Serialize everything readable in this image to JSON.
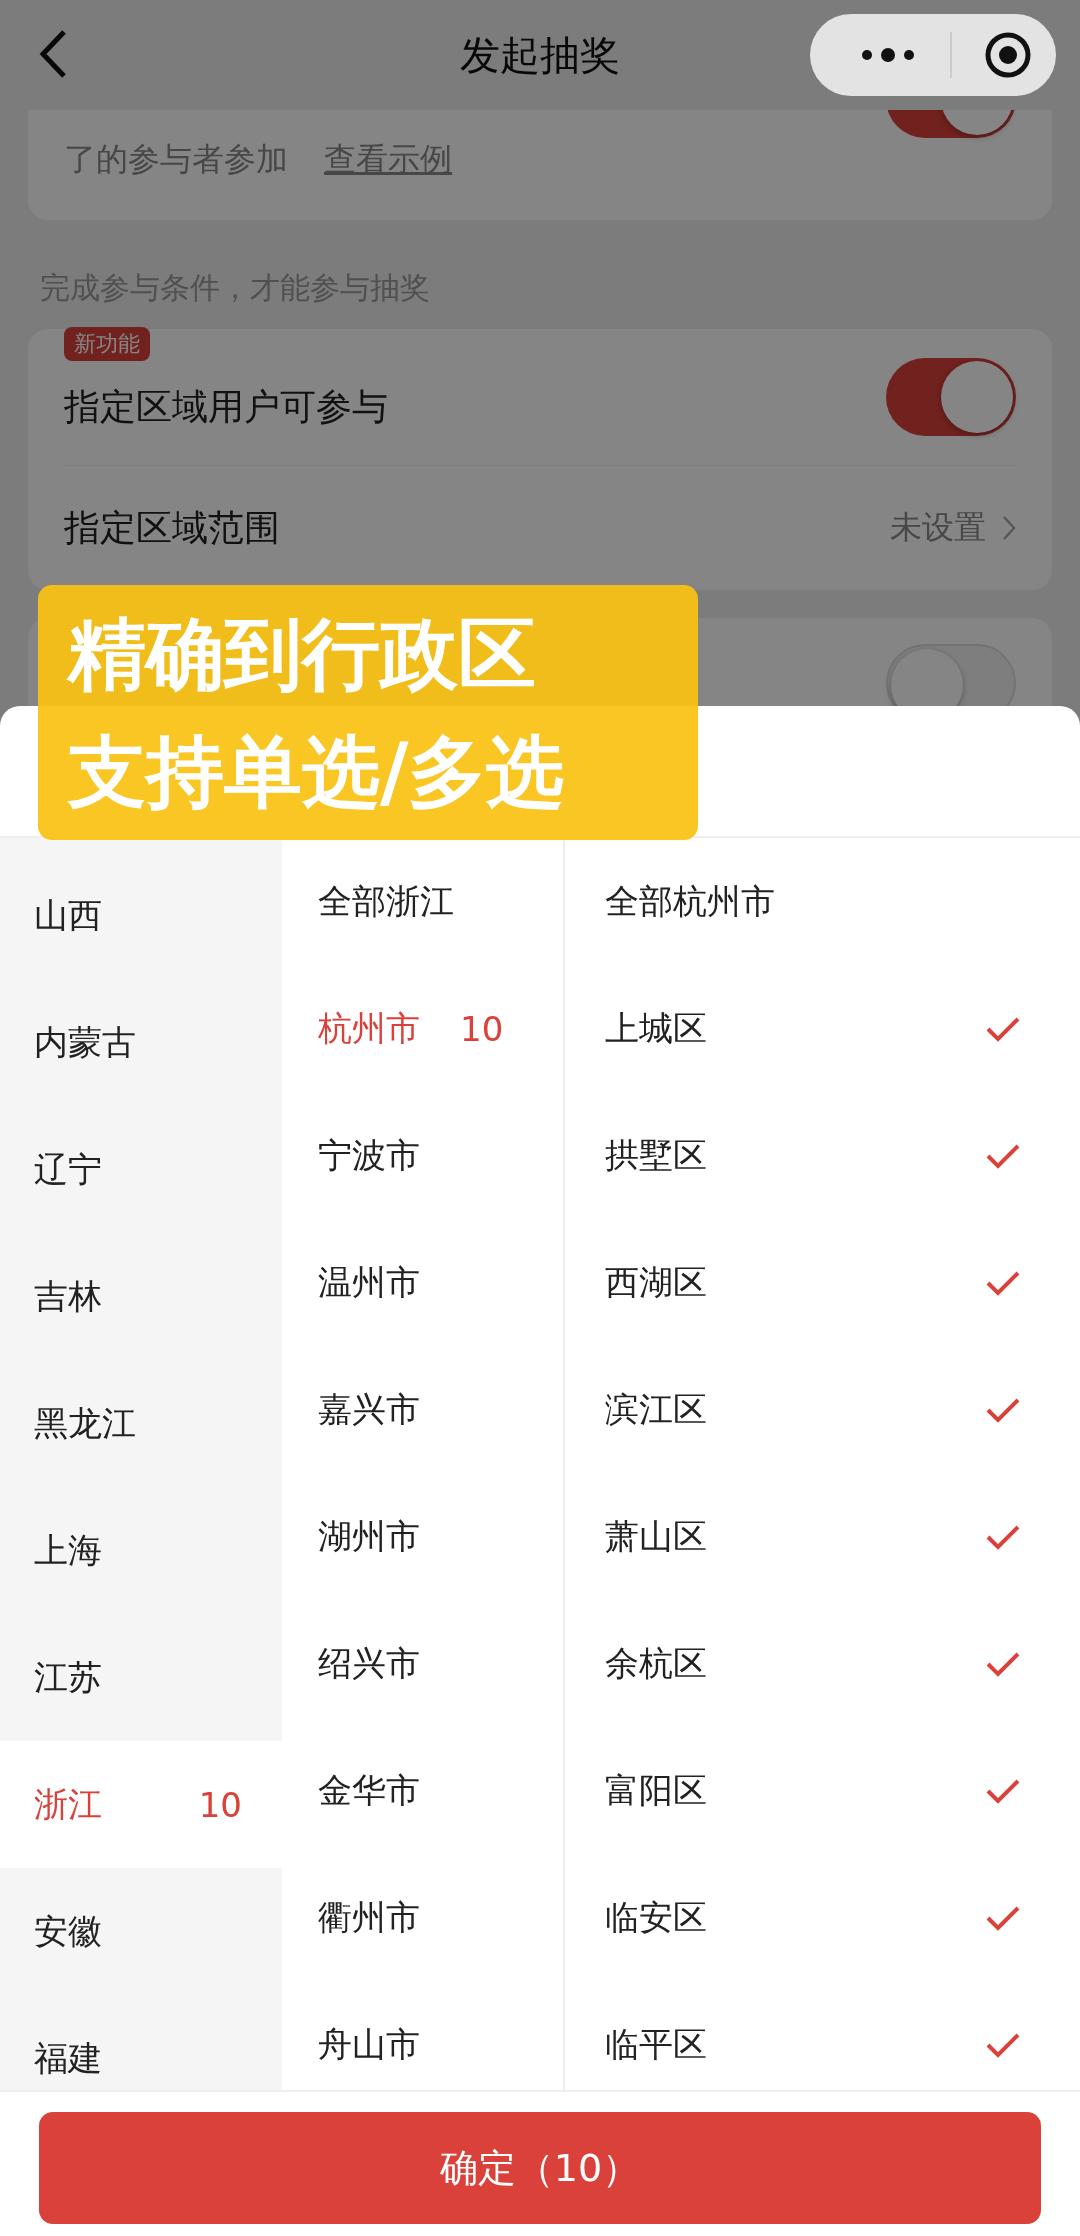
{
  "header": {
    "title": "发起抽奖"
  },
  "background": {
    "top_card": {
      "text": "了的参与者参加",
      "link": "查看示例",
      "on": true
    },
    "section_label": "完成参与条件，才能参与抽奖",
    "rows": [
      {
        "kind": "toggle",
        "badge": "新功能",
        "label": "指定区域用户可参与",
        "on": true
      },
      {
        "kind": "nav",
        "label": "指定区域范围",
        "value": "未设置"
      }
    ],
    "bottom_card": {
      "on": false
    }
  },
  "caption": [
    "精确到行政区",
    "支持单选/多选"
  ],
  "provinces": [
    {
      "name": "山西",
      "selected": false
    },
    {
      "name": "内蒙古",
      "selected": false
    },
    {
      "name": "辽宁",
      "selected": false
    },
    {
      "name": "吉林",
      "selected": false
    },
    {
      "name": "黑龙江",
      "selected": false
    },
    {
      "name": "上海",
      "selected": false
    },
    {
      "name": "江苏",
      "selected": false
    },
    {
      "name": "浙江",
      "selected": true,
      "count": "10"
    },
    {
      "name": "安徽",
      "selected": false
    },
    {
      "name": "福建",
      "selected": false
    }
  ],
  "cities": [
    {
      "name": "全部浙江",
      "selected": false
    },
    {
      "name": "杭州市",
      "selected": true,
      "count": "10"
    },
    {
      "name": "宁波市",
      "selected": false
    },
    {
      "name": "温州市",
      "selected": false
    },
    {
      "name": "嘉兴市",
      "selected": false
    },
    {
      "name": "湖州市",
      "selected": false
    },
    {
      "name": "绍兴市",
      "selected": false
    },
    {
      "name": "金华市",
      "selected": false
    },
    {
      "name": "衢州市",
      "selected": false
    },
    {
      "name": "舟山市",
      "selected": false
    }
  ],
  "districts": [
    {
      "name": "全部杭州市",
      "checked": false
    },
    {
      "name": "上城区",
      "checked": true
    },
    {
      "name": "拱墅区",
      "checked": true
    },
    {
      "name": "西湖区",
      "checked": true
    },
    {
      "name": "滨江区",
      "checked": true
    },
    {
      "name": "萧山区",
      "checked": true
    },
    {
      "name": "余杭区",
      "checked": true
    },
    {
      "name": "富阳区",
      "checked": true
    },
    {
      "name": "临安区",
      "checked": true
    },
    {
      "name": "临平区",
      "checked": true
    }
  ],
  "confirm": "确定（10）"
}
